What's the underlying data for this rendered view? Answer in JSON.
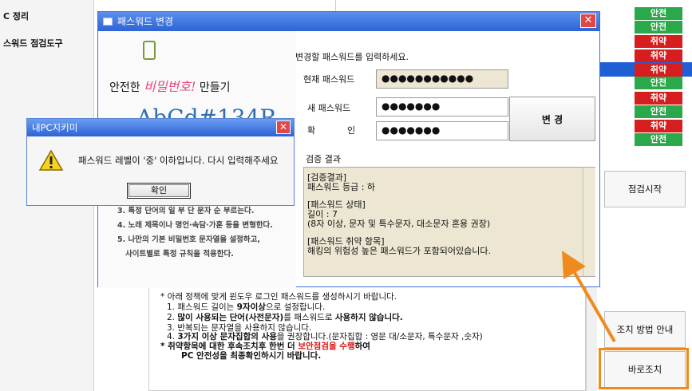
{
  "sidebar": {
    "items": [
      {
        "label": "C 정리"
      },
      {
        "label": "스워드 점검도구"
      }
    ]
  },
  "status_badges": [
    {
      "label": "안전",
      "status": "safe"
    },
    {
      "label": "안전",
      "status": "safe"
    },
    {
      "label": "취약",
      "status": "weak"
    },
    {
      "label": "취약",
      "status": "weak"
    },
    {
      "label": "취약",
      "status": "weak"
    },
    {
      "label": "안전",
      "status": "safe"
    },
    {
      "label": "취약",
      "status": "weak"
    },
    {
      "label": "안전",
      "status": "safe"
    },
    {
      "label": "취약",
      "status": "weak"
    },
    {
      "label": "안전",
      "status": "safe"
    }
  ],
  "colors": {
    "safe": "#2aa84a",
    "weak": "#d61e1e",
    "title_bar": "#2d63d3",
    "highlight": "#f08a1c"
  },
  "side_buttons": {
    "start_check": "점검시작",
    "fix_guide": "조치 방법 안내",
    "fix_now": "바로조치"
  },
  "guide": {
    "line1": "* 아래 정책에 맞게 윈도우 로그인 패스워드를 생성하시기 바랍니다.",
    "line2_a": "1. 패스워드 길이는 ",
    "line2_b": "9자이상",
    "line2_c": "으로 설정합니다.",
    "line3_a": "2. ",
    "line3_b": "많이 사용되는 단어(사전문자)",
    "line3_c": "를 패스워드로 ",
    "line3_d": "사용하지 않습니다.",
    "line4": "3. 반복되는 문자열을 사용하지 않습니다.",
    "line5_a": "4. ",
    "line5_b": "3가지 이상 문자집합의 사용",
    "line5_c": "을 권장합니다.(문자집합 : 영문 대/소문자, 특수문자 ,숫자)",
    "line6_a": "* 취약항목에 대한 후속조치후 한번 더 ",
    "line6_b": "보안점검을 수행",
    "line6_c": "하여",
    "line7": "PC 안전성을 최종확인하시기 바랍니다."
  },
  "pw_dialog": {
    "title": "패스워드 변경",
    "art_line1_a": "안전한 ",
    "art_line1_b": "비밀번호!",
    "art_line1_c": " 만들기",
    "art_big": "AbCd#134R",
    "tips": [
      "3. 특정 단어의 일 부 단 문자 순 부르는다.",
      "4. 노래 제목이나 명언·속담·가훈 등을 변형한다.",
      "5. 나만의 기본 비밀번호 문자열을 설정하고,",
      "사이트별로 특정 규칙을 적용한다."
    ],
    "prompt": "변경할 패스워드를 입력하세요.",
    "current_label": "현재 패스워드",
    "current_value": "●●●●●●●●●●●",
    "new_label": "새 패스워드",
    "new_value": "●●●●●●●",
    "confirm_label": "확",
    "confirm_label2": "인",
    "confirm_value": "●●●●●●●",
    "change_button": "변 경",
    "result_label": "검증 결과",
    "result_lines": [
      "[검증결과]",
      "패스워드 등급 : 하",
      "[패스워드 상태]",
      "길이 : 7",
      "(8자 이상, 문자 및 특수문자, 대소문자 혼용 권장)",
      "[패스워드 취약 항목]",
      "해킹의 위험성 높은 패스워드가 포함되어있습니다."
    ]
  },
  "alert": {
    "title": "내PC지키미",
    "message": "패스워드 레벨이 '중' 이하입니다. 다시 입력해주세요",
    "ok_button": "확인"
  }
}
